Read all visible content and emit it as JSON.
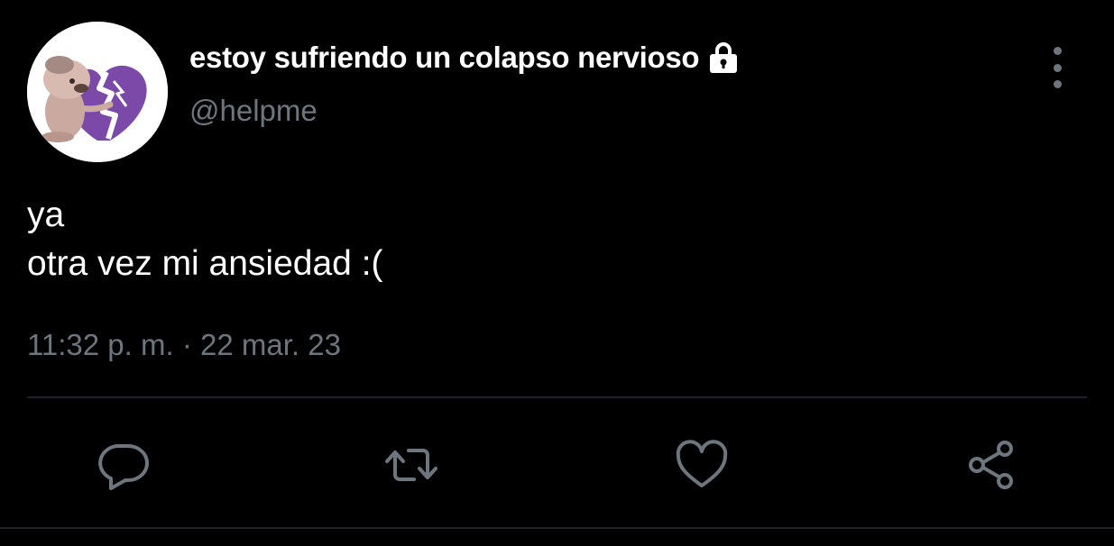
{
  "tweet": {
    "display_name": "estoy sufriendo un colapso nervioso",
    "handle": "@helpme",
    "protected": true,
    "text_lines": [
      "ya",
      "otra vez mi ansiedad :("
    ],
    "time": "11:32 p. m.",
    "separator": "·",
    "date": "22 mar. 23"
  },
  "icons": {
    "lock": "lock-icon",
    "more": "more-vertical-icon",
    "reply": "reply-icon",
    "retweet": "retweet-icon",
    "like": "heart-icon",
    "share": "share-icon"
  },
  "colors": {
    "background": "#000000",
    "text": "#ffffff",
    "secondary": "#6e767d",
    "divider": "#1f2327",
    "avatar_heart": "#7b4aa8"
  }
}
